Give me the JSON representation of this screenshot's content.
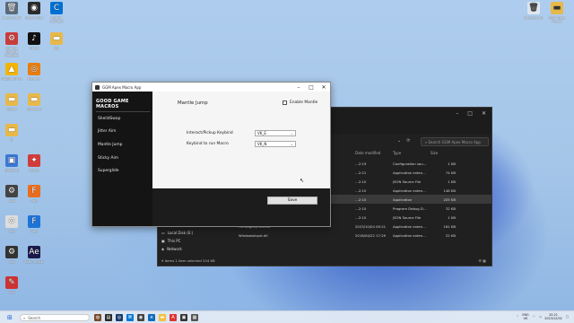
{
  "desktop": {
    "icons_left": [
      {
        "label": "Recycle Bin",
        "color": "#5a6a7a",
        "glyph": "🗑"
      },
      {
        "label": "OBS Studio",
        "color": "#2b2b2b",
        "glyph": "◉"
      },
      {
        "label": "Ubisoft Connect",
        "color": "#0070d1",
        "glyph": "C"
      },
      {
        "label": "Chrome Remote Desktop",
        "color": "#cc3b3b",
        "glyph": "⚙"
      },
      {
        "label": "TikTok",
        "color": "#111111",
        "glyph": "♪"
      },
      {
        "label": "old",
        "color": "#e8b84a",
        "glyph": "▬"
      },
      {
        "label": "Google Drive",
        "color": "#f4b400",
        "glyph": "▲"
      },
      {
        "label": "Blender",
        "color": "#e87d0d",
        "glyph": "◎"
      },
      {
        "label": "Folder",
        "color": "#e8b84a",
        "glyph": "▬"
      },
      {
        "label": "Shortcut",
        "color": "#e8b84a",
        "glyph": "▬"
      },
      {
        "label": "fb",
        "color": "#e8b84a",
        "glyph": "▬"
      },
      {
        "label": "Shortcut",
        "color": "#3a78d6",
        "glyph": "▣"
      },
      {
        "label": "VeRay",
        "color": "#d23b3b",
        "glyph": "✦"
      },
      {
        "label": "Tools",
        "color": "#444444",
        "glyph": "⚙"
      },
      {
        "label": "App",
        "color": "#e96d1e",
        "glyph": "F"
      },
      {
        "label": "Tool",
        "color": "#dddddd",
        "glyph": "⚙"
      },
      {
        "label": "App",
        "color": "#1e73d6",
        "glyph": "F"
      },
      {
        "label": "Tool",
        "color": "#333333",
        "glyph": "⚙"
      },
      {
        "label": "After Effects",
        "color": "#1a1a4a",
        "glyph": "Ae"
      },
      {
        "label": "Tool",
        "color": "#cc3333",
        "glyph": "✎"
      }
    ],
    "icons_right": [
      {
        "label": "Recycle Bin",
        "color": "#dfe6ee",
        "glyph": "🗑"
      },
      {
        "label": "GSM Apex Macro",
        "color": "#e8b84a",
        "glyph": "▬"
      }
    ]
  },
  "explorer": {
    "search_placeholder": "Search GGM Apex Macro App",
    "columns": [
      "Date modified",
      "Type",
      "Size"
    ],
    "rows": [
      {
        "name": "",
        "date": "…2:19",
        "type": "Configuration sou…",
        "size": "1 KB"
      },
      {
        "name": "",
        "date": "…2:21",
        "type": "Application exten…",
        "size": "74 KB"
      },
      {
        "name": "",
        "date": "…2:10",
        "type": "JSON Source File",
        "size": "1 KB"
      },
      {
        "name": "",
        "date": "…2:10",
        "type": "Application exten…",
        "size": "148 KB"
      },
      {
        "name": "",
        "date": "…2:10",
        "type": "Application",
        "size": "205 KB"
      },
      {
        "name": "",
        "date": "…2:10",
        "type": "Program Debug D…",
        "size": "32 KB"
      },
      {
        "name": "",
        "date": "…2:10",
        "type": "JSON Source File",
        "size": "1 KB"
      },
      {
        "name": "HtmlAgilityPack.dll",
        "date": "2023/10/04 00:21",
        "type": "Application exten…",
        "size": "161 KB"
      },
      {
        "name": "WindowsInput.dll",
        "date": "2018/04/22 17:29",
        "type": "Application exten…",
        "size": "22 KB"
      }
    ],
    "nav": [
      "Local Disk (E:)",
      "This PC",
      "Network"
    ],
    "status": "9 items   1 item selected  204 KB"
  },
  "app": {
    "title": "GGM Apex Macro App",
    "logo": "GOOD GAME MACROS",
    "sidebar_items": [
      "SheildSwap",
      "Jitter Aim",
      "Mantle Jump",
      "Sticky Aim",
      "Superglide"
    ],
    "page_title": "Mantle Jump",
    "enable_label": "Enable Mantle",
    "enable_checked": false,
    "fields": [
      {
        "label": "Interact/Pickup Keybind",
        "value": "VK_E"
      },
      {
        "label": "Keybind to run Macro",
        "value": "VK_N"
      }
    ],
    "save_label": "Save"
  },
  "taskbar": {
    "search_placeholder": "Search",
    "lang": "ENG",
    "region": "UK",
    "time": "20:21",
    "date": "2023/12/02"
  }
}
